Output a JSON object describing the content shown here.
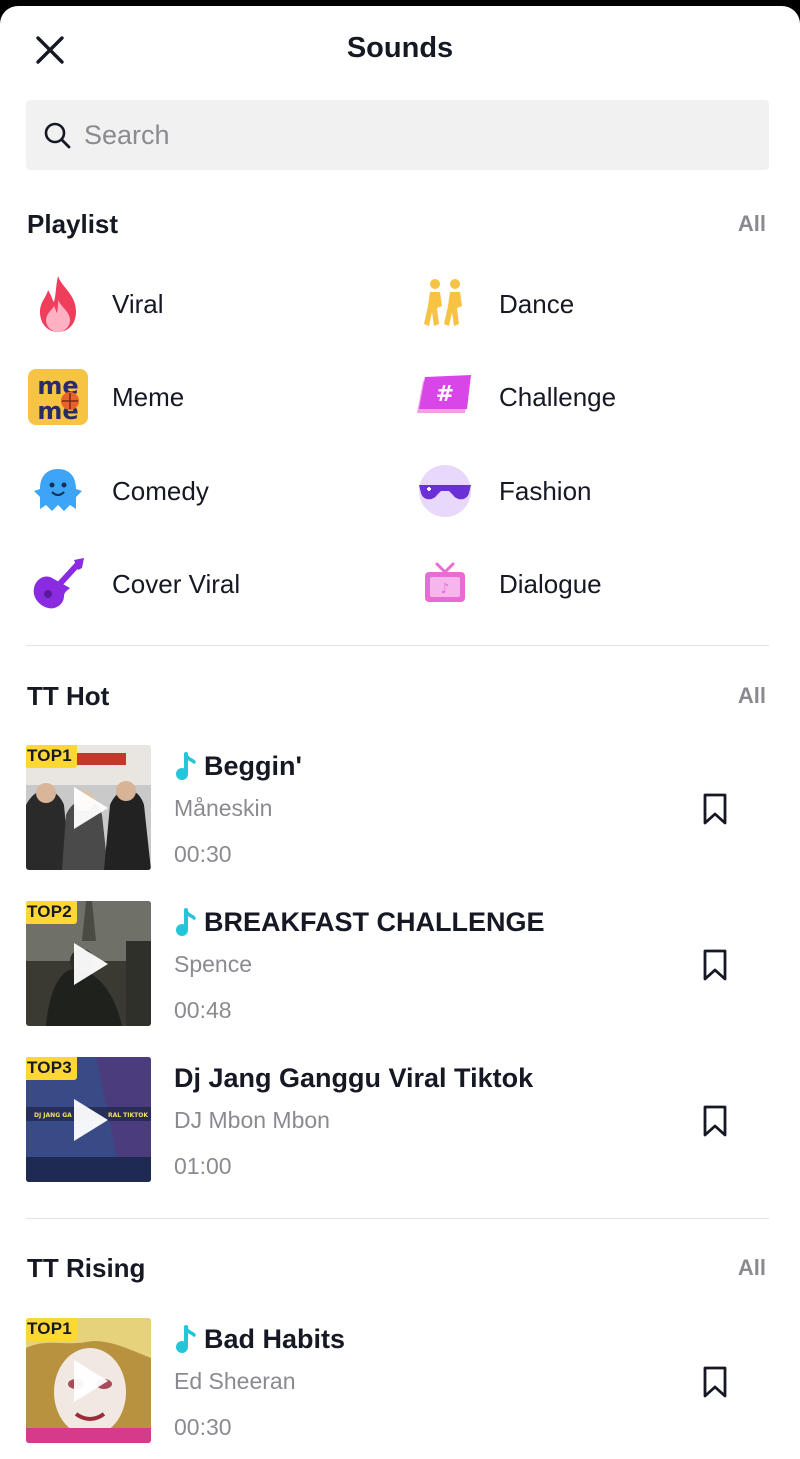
{
  "header": {
    "title": "Sounds"
  },
  "search": {
    "placeholder": "Search"
  },
  "playlist": {
    "title": "Playlist",
    "all_label": "All",
    "items": [
      {
        "label": "Viral",
        "icon": "flame-icon"
      },
      {
        "label": "Dance",
        "icon": "dancers-icon"
      },
      {
        "label": "Meme",
        "icon": "meme-icon"
      },
      {
        "label": "Challenge",
        "icon": "hashtag-icon"
      },
      {
        "label": "Comedy",
        "icon": "ghost-icon"
      },
      {
        "label": "Fashion",
        "icon": "sunglasses-icon"
      },
      {
        "label": "Cover Viral",
        "icon": "guitar-icon"
      },
      {
        "label": "Dialogue",
        "icon": "tv-icon"
      }
    ]
  },
  "tt_hot": {
    "title": "TT Hot",
    "all_label": "All",
    "tracks": [
      {
        "badge": "TOP1",
        "title": "Beggin'",
        "artist": "Måneskin",
        "duration": "00:30",
        "original": true
      },
      {
        "badge": "TOP2",
        "title": "BREAKFAST CHALLENGE",
        "artist": "Spence",
        "duration": "00:48",
        "original": true
      },
      {
        "badge": "TOP3",
        "title": "Dj Jang Ganggu Viral Tiktok",
        "artist": "DJ Mbon Mbon",
        "duration": "01:00",
        "original": false
      }
    ]
  },
  "tt_rising": {
    "title": "TT Rising",
    "all_label": "All",
    "tracks": [
      {
        "badge": "TOP1",
        "title": "Bad Habits",
        "artist": "Ed Sheeran",
        "duration": "00:30",
        "original": true
      }
    ]
  },
  "colors": {
    "badge": "#fdd835",
    "note": "#25c5d9",
    "muted": "#8a8b91"
  }
}
